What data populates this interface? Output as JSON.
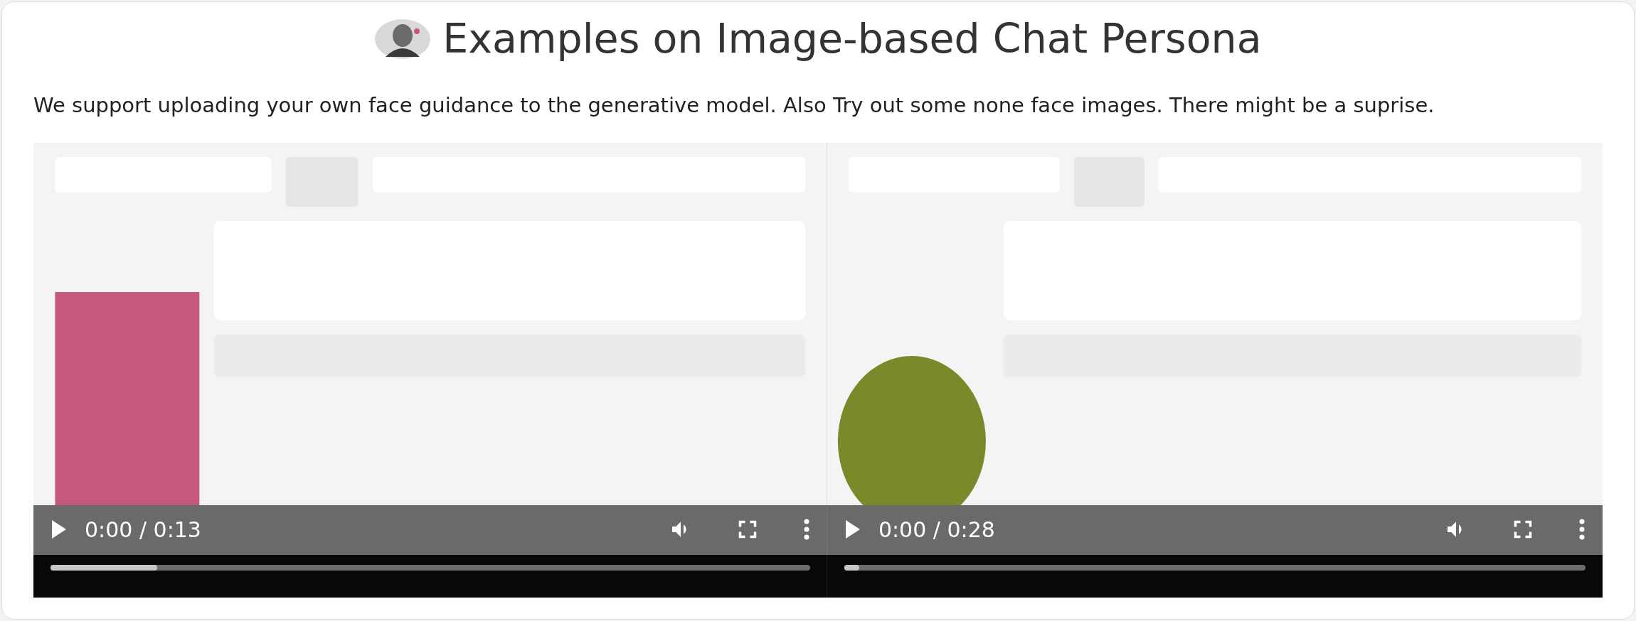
{
  "heading": {
    "title": "Examples on Image-based Chat Persona"
  },
  "description": "We support uploading your own face guidance to the generative model. Also Try out some none face images. There might be a suprise.",
  "videos": [
    {
      "time": "0:00 / 0:13",
      "level": 0.14
    },
    {
      "time": "0:00 / 0:28",
      "level": 0.02
    }
  ]
}
